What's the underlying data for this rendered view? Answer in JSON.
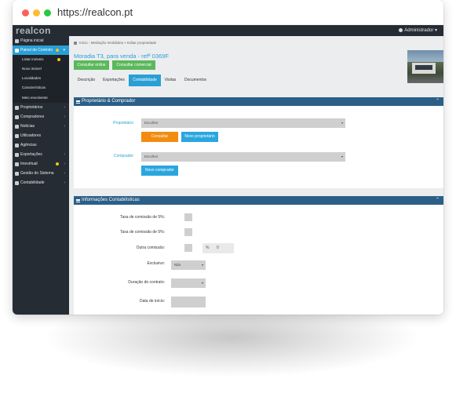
{
  "browser": {
    "url": "https://realcon.pt"
  },
  "app": {
    "logo": "realcon",
    "user": "Administrador"
  },
  "sidebar": {
    "items": [
      {
        "label": "Página inicial"
      },
      {
        "label": "Painel de Controlo",
        "active": true
      },
      {
        "label": "Proprietários"
      },
      {
        "label": "Compradores"
      },
      {
        "label": "Notícias"
      },
      {
        "label": "Utilizadores"
      },
      {
        "label": "Agências"
      },
      {
        "label": "Exportações"
      },
      {
        "label": "Imovirtual"
      },
      {
        "label": "Gestão do Sistema"
      },
      {
        "label": "Contabilidade"
      }
    ],
    "subitems": [
      {
        "label": "Listar imóveis"
      },
      {
        "label": "Novo imóvel"
      },
      {
        "label": "Localidades"
      },
      {
        "label": "Características"
      },
      {
        "label": "Meio envolvente"
      }
    ]
  },
  "breadcrumb": {
    "text": "Início - Mediação Imobiliária > Editar propriedade"
  },
  "page": {
    "title": "Moradia T3, para venda - refª 0369F",
    "btn_online": "Consultar online",
    "btn_comercial": "Consultar comercial"
  },
  "tabs": [
    "Descrição",
    "Exportações",
    "Contabilidade",
    "Visitas",
    "Documentos"
  ],
  "panel1": {
    "title": "Proprietário & Comprador",
    "owner_label": "Proprietário",
    "owner_select": "Escolher",
    "btn_consultar": "Consultar",
    "btn_novo_proprietario": "Novo proprietário",
    "buyer_label": "Comprador",
    "buyer_select": "Escolher",
    "btn_novo_comprador": "Novo comprador"
  },
  "panel2": {
    "title": "Informações Contabilísticas",
    "rows": [
      {
        "label": "Taxa de comissão de 5%:"
      },
      {
        "label": "Taxa de comissão de 5%:"
      },
      {
        "label": "Outra comissão:"
      },
      {
        "label": "Exclusivo:"
      },
      {
        "label": "Duração do contrato:"
      },
      {
        "label": "Data de início:"
      }
    ],
    "pct_symbol": "%",
    "pct_value": "0",
    "exclusivo_value": "Não"
  }
}
